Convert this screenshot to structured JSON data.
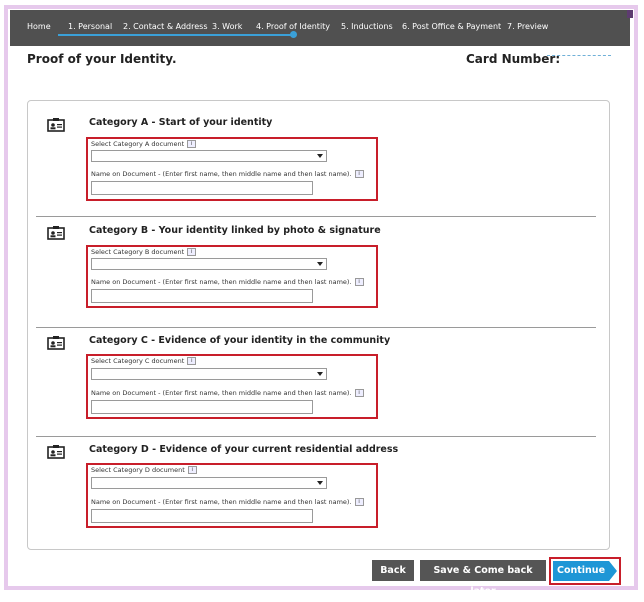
{
  "nav": {
    "items": [
      {
        "label": "Home"
      },
      {
        "label": "1. Personal"
      },
      {
        "label": "2. Contact & Address"
      },
      {
        "label": "3. Work"
      },
      {
        "label": "4. Proof of Identity"
      },
      {
        "label": "5. Inductions"
      },
      {
        "label": "6. Post Office & Payment"
      },
      {
        "label": "7. Preview"
      }
    ],
    "active_index": 4,
    "progress_color": "#3aa0d8"
  },
  "page": {
    "title": "Proof of your Identity.",
    "card_number_label": "Card Number:"
  },
  "sections": [
    {
      "title": "Category A - Start of your identity",
      "select_label": "Select Category A document",
      "select_value": "",
      "name_label": "Name on Document - (Enter first name, then middle name and then last name).",
      "name_value": ""
    },
    {
      "title": "Category B - Your identity linked by photo & signature",
      "select_label": "Select Category B document",
      "select_value": "",
      "name_label": "Name on Document - (Enter first name, then middle name and then last name).",
      "name_value": ""
    },
    {
      "title": "Category C - Evidence of your identity in the community",
      "select_label": "Select Category C document",
      "select_value": "",
      "name_label": "Name on Document - (Enter first name, then middle name and then last name).",
      "name_value": ""
    },
    {
      "title": "Category D - Evidence of your current residential address",
      "select_label": "Select Category D document",
      "select_value": "",
      "name_label": "Name on Document - (Enter first name, then middle name and then last name).",
      "name_value": ""
    }
  ],
  "info_glyph": "i",
  "buttons": {
    "back": "Back",
    "save": "Save & Come back later",
    "continue": "Continue"
  },
  "colors": {
    "highlight": "#c81e2a",
    "nav_bg": "#505050",
    "continue_bg": "#1e96d6",
    "frame": "#e6c9ec"
  }
}
